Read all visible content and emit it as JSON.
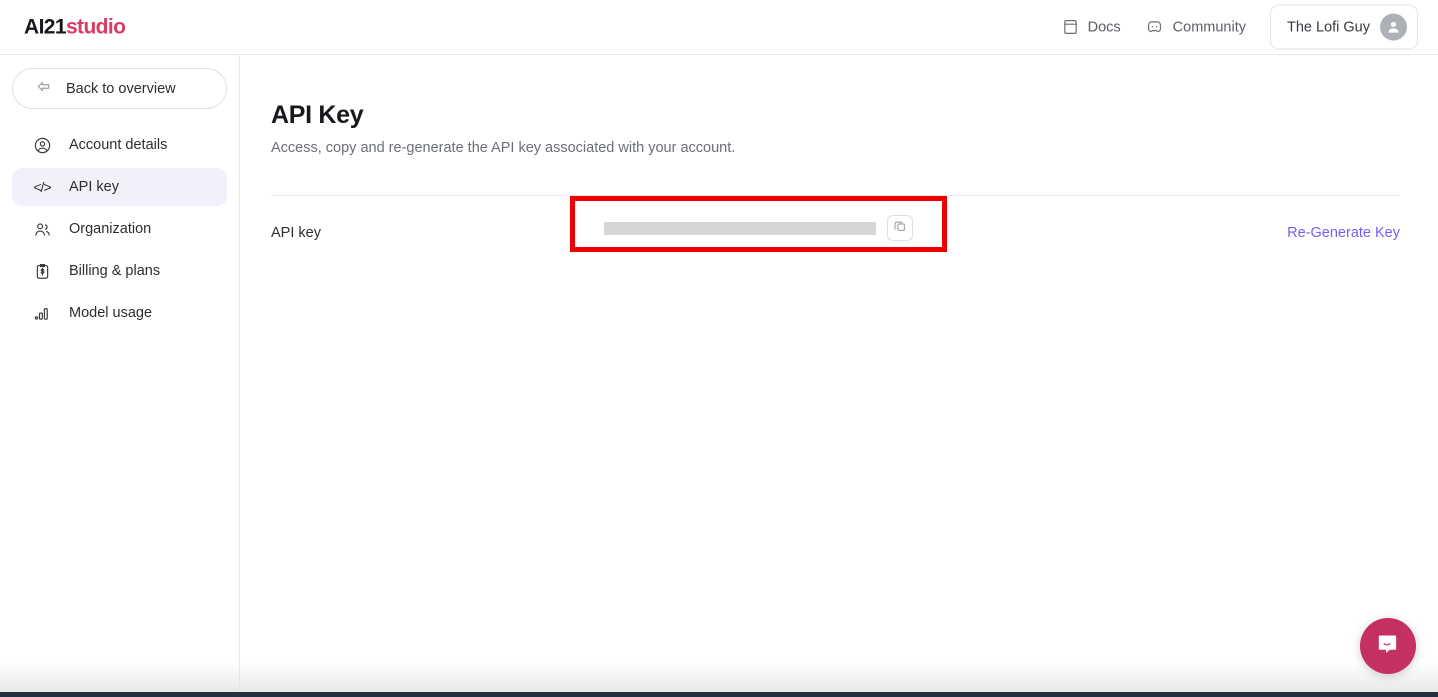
{
  "header": {
    "logo": {
      "primary": "AI21",
      "accent": "studio"
    },
    "links": [
      {
        "label": "Docs",
        "icon": "book-icon"
      },
      {
        "label": "Community",
        "icon": "discord-icon"
      }
    ],
    "user": {
      "name": "The Lofi Guy",
      "icon": "avatar-icon"
    }
  },
  "sidebar": {
    "back": {
      "label": "Back to overview",
      "icon": "arrow-left-icon"
    },
    "items": [
      {
        "label": "Account details",
        "icon": "user-circle-icon",
        "active": false
      },
      {
        "label": "API key",
        "icon": "code-icon",
        "active": true
      },
      {
        "label": "Organization",
        "icon": "users-icon",
        "active": false
      },
      {
        "label": "Billing & plans",
        "icon": "billing-clipboard-icon",
        "active": false
      },
      {
        "label": "Model usage",
        "icon": "bar-chart-icon",
        "active": false
      }
    ]
  },
  "main": {
    "title": "API Key",
    "subtitle": "Access, copy and re-generate the API key associated with your account.",
    "row": {
      "label": "API key",
      "value_masked": "",
      "copy_icon": "copy-icon",
      "regenerate_label": "Re-Generate Key"
    }
  },
  "annotation": {
    "highlight_color": "#EE0000"
  },
  "chat": {
    "icon": "chat-bubble-icon",
    "color": "#C43060"
  },
  "colors": {
    "brand_pink": "#D93B63",
    "accent_purple": "#7C5CF5",
    "active_nav_bg": "#F2F0FB",
    "bottom_bar": "#22333F"
  }
}
